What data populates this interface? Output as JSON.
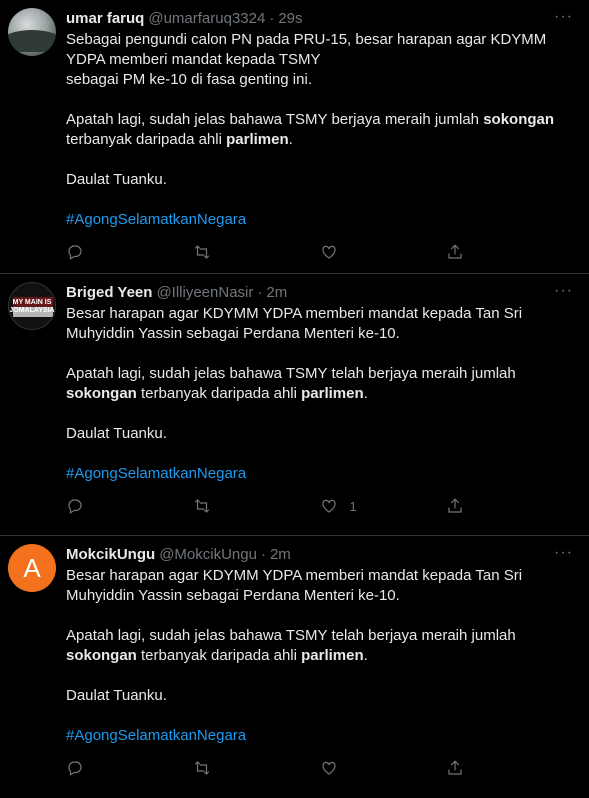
{
  "tweets": [
    {
      "name": "umar faruq",
      "handle": "@umarfaruq3324",
      "time": "29s",
      "lines": [
        "Sebagai pengundi calon PN pada PRU-15, besar harapan agar KDYMM",
        "YDPA memberi mandat kepada TSMY",
        "sebagai PM ke-10 di fasa genting ini."
      ],
      "para2_a": "Apatah lagi, sudah jelas bahawa TSMY  berjaya meraih jumlah ",
      "para2_b1": "sokongan",
      "para2_c": "terbanyak daripada ahli ",
      "para2_b2": "parlimen",
      "para2_d": ".",
      "closing": "Daulat Tuanku.",
      "hashtag": "#AgongSelamatkanNegara",
      "like_count": ""
    },
    {
      "name": "Briged Yeen",
      "handle": "@IlliyeenNasir",
      "time": "2m",
      "avatar_text": "MY MAIN IS JOMALAYSIA",
      "line1": "Besar harapan agar KDYMM YDPA memberi mandat kepada Tan Sri",
      "line2": "Muhyiddin Yassin sebagai Perdana Menteri ke-10.",
      "line3": "Apatah lagi, sudah jelas bahawa TSMY telah berjaya meraih jumlah",
      "bold1": "sokongan",
      "mid": " terbanyak daripada ahli ",
      "bold2": "parlimen",
      "end": ".",
      "closing": "Daulat Tuanku.",
      "hashtag": "#AgongSelamatkanNegara",
      "like_count": "1"
    },
    {
      "name": "MokcikUngu",
      "handle": "@MokcikUngu",
      "time": "2m",
      "avatar_letter": "A",
      "line1": "Besar harapan agar KDYMM YDPA memberi mandat kepada Tan Sri",
      "line2": "Muhyiddin Yassin sebagai Perdana Menteri ke-10.",
      "line3": "Apatah lagi, sudah jelas bahawa TSMY telah berjaya meraih jumlah",
      "bold1": "sokongan",
      "mid": " terbanyak daripada ahli ",
      "bold2": "parlimen",
      "end": ".",
      "closing": "Daulat Tuanku.",
      "hashtag": "#AgongSelamatkanNegara",
      "like_count": ""
    }
  ],
  "separator_dot": "·",
  "more_glyph": "···",
  "colors": {
    "background": "#000000",
    "text": "#e7e9ea",
    "muted": "#71767b",
    "link": "#1d9bf0",
    "avatar_orange": "#f4711d"
  }
}
